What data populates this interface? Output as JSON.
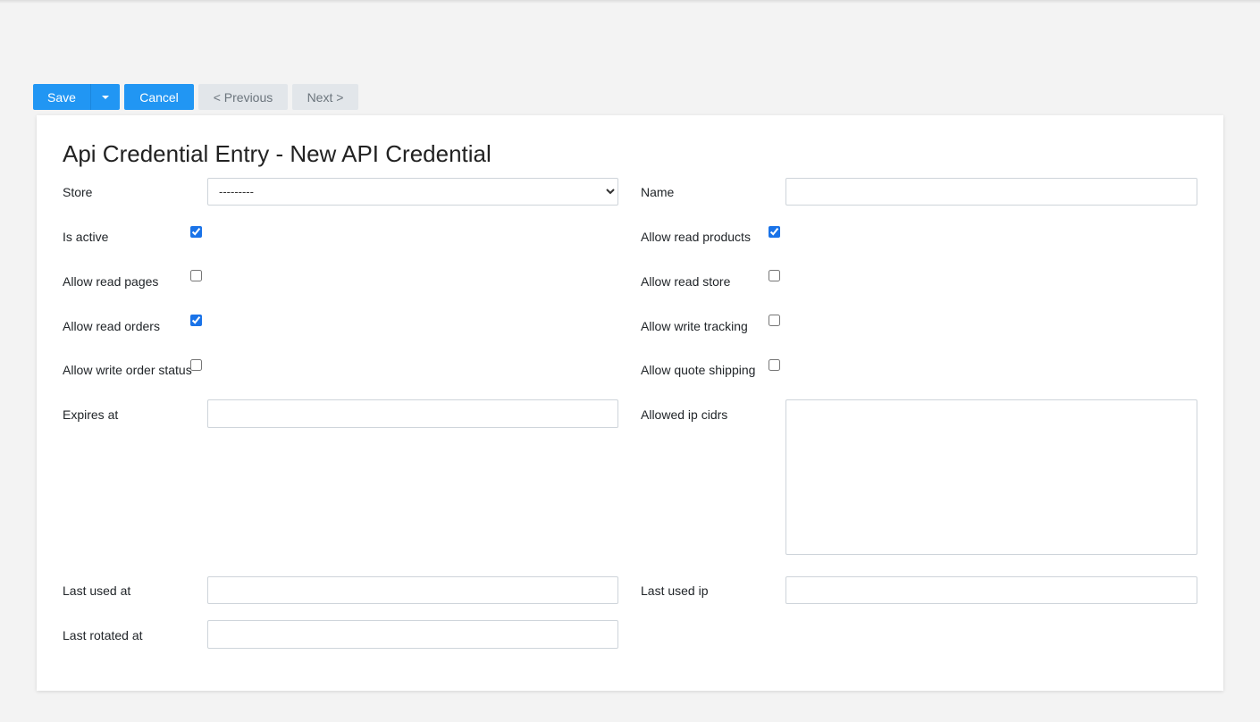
{
  "toolbar": {
    "save_label": "Save",
    "cancel_label": "Cancel",
    "previous_label": "< Previous",
    "next_label": "Next >"
  },
  "page": {
    "title": "Api Credential Entry - New API Credential"
  },
  "fields": {
    "store": {
      "label": "Store",
      "value": "---------",
      "options": [
        "---------"
      ]
    },
    "name": {
      "label": "Name",
      "value": ""
    },
    "is_active": {
      "label": "Is active",
      "checked": true
    },
    "allow_read_products": {
      "label": "Allow read products",
      "checked": true
    },
    "allow_read_pages": {
      "label": "Allow read pages",
      "checked": false
    },
    "allow_read_store": {
      "label": "Allow read store",
      "checked": false
    },
    "allow_read_orders": {
      "label": "Allow read orders",
      "checked": true
    },
    "allow_write_tracking": {
      "label": "Allow write tracking",
      "checked": false
    },
    "allow_write_order_status": {
      "label": "Allow write order status",
      "checked": false
    },
    "allow_quote_shipping": {
      "label": "Allow quote shipping",
      "checked": false
    },
    "expires_at": {
      "label": "Expires at",
      "value": ""
    },
    "allowed_ip_cidrs": {
      "label": "Allowed ip cidrs",
      "value": ""
    },
    "last_used_at": {
      "label": "Last used at",
      "value": ""
    },
    "last_used_ip": {
      "label": "Last used ip",
      "value": ""
    },
    "last_rotated_at": {
      "label": "Last rotated at",
      "value": ""
    }
  },
  "colors": {
    "primary": "#2196f3",
    "disabled": "#e2e6ea",
    "background": "#f3f3f3"
  }
}
